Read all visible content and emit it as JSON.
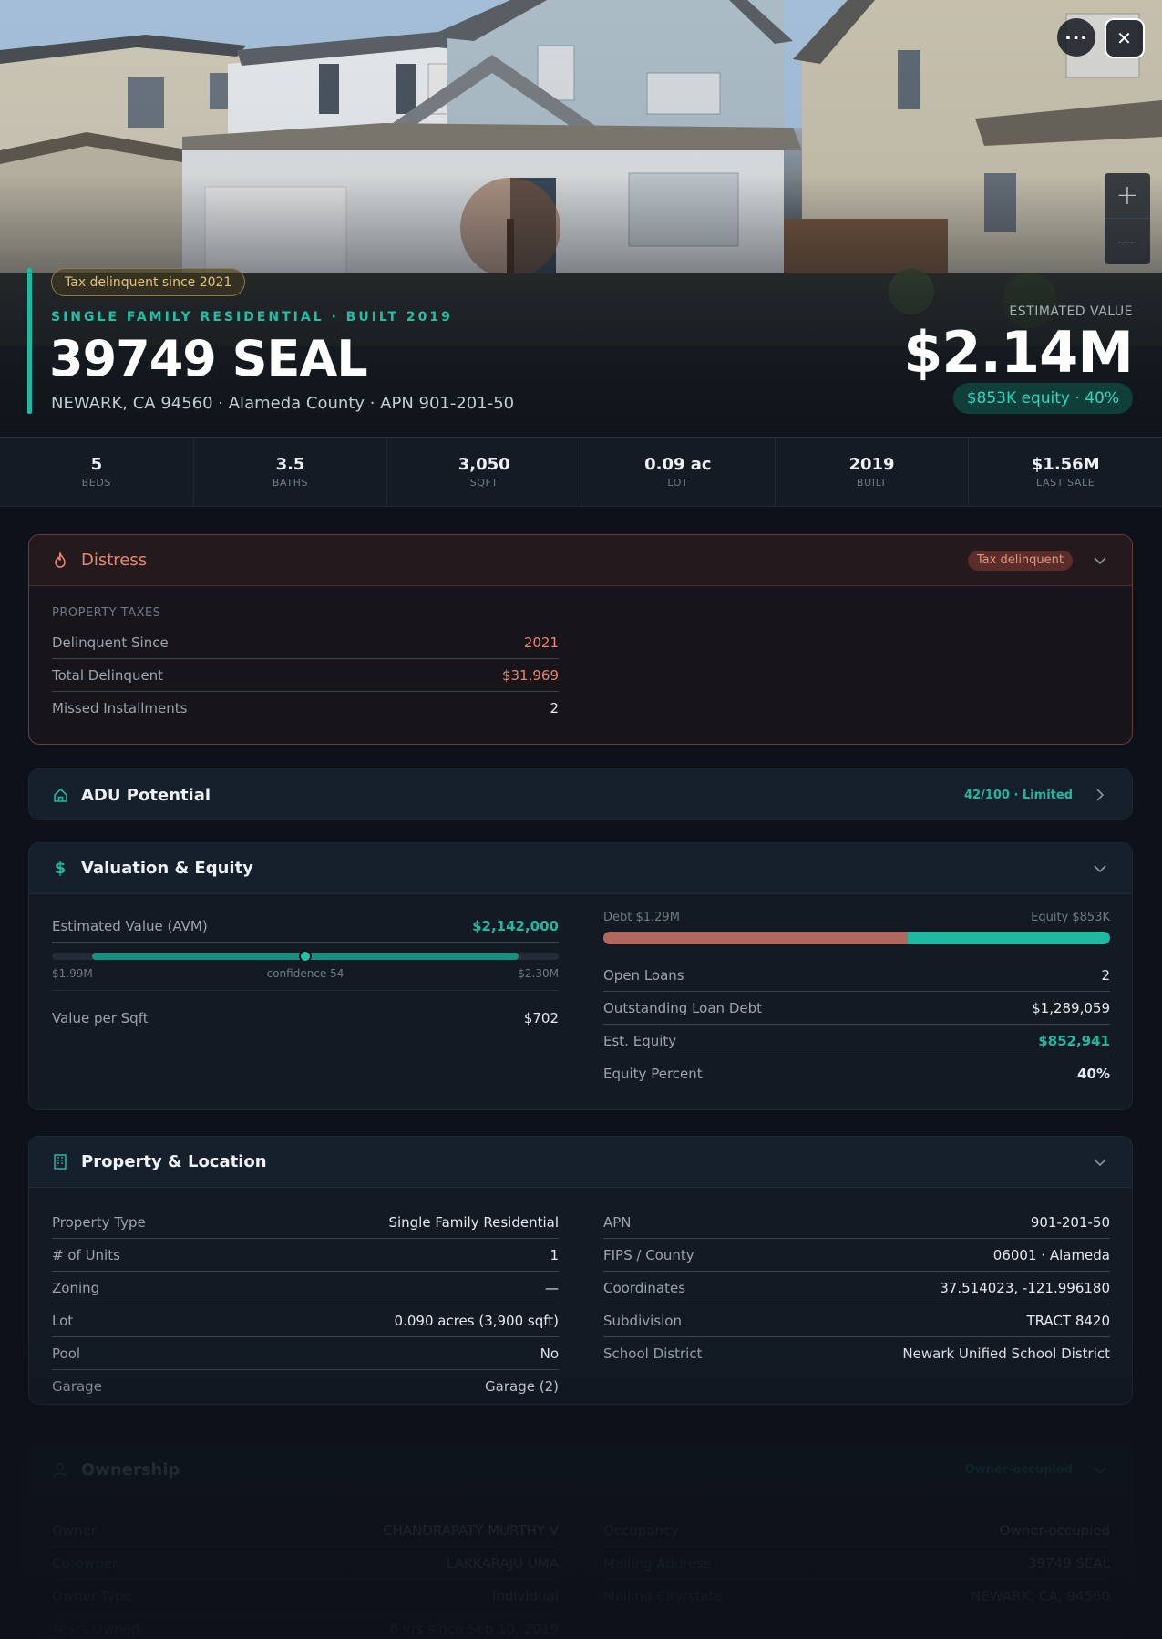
{
  "hero": {
    "tax_badge": "Tax delinquent since 2021",
    "subtitle": "SINGLE FAMILY RESIDENTIAL · BUILT 2019",
    "address": "39749 SEAL",
    "location": "NEWARK, CA 94560 · Alameda County · APN 901-201-50",
    "est_label": "ESTIMATED VALUE",
    "est_value": "$2.14M",
    "equity_badge": "$853K equity · 40%",
    "more_icon": "···",
    "close_icon": "✕",
    "zoom_in": "+",
    "zoom_out": "−"
  },
  "stats": [
    {
      "value": "5",
      "label": "BEDS"
    },
    {
      "value": "3.5",
      "label": "BATHS"
    },
    {
      "value": "3,050",
      "label": "SQFT"
    },
    {
      "value": "0.09 ac",
      "label": "LOT"
    },
    {
      "value": "2019",
      "label": "BUILT"
    },
    {
      "value": "$1.56M",
      "label": "LAST SALE"
    }
  ],
  "distress": {
    "title": "Distress",
    "badge": "Tax delinquent",
    "section_label": "PROPERTY TAXES",
    "rows": [
      {
        "k": "Delinquent Since",
        "v": "2021"
      },
      {
        "k": "Total Delinquent",
        "v": "$31,969"
      },
      {
        "k": "Missed Installments",
        "v": "2"
      }
    ]
  },
  "adu": {
    "title": "ADU Potential",
    "badge": "42/100 · Limited"
  },
  "valuation": {
    "title": "Valuation & Equity",
    "avm_label": "Estimated Value (AVM)",
    "avm_value": "$2,142,000",
    "range_low": "$1.99M",
    "confidence": "confidence 54",
    "range_high": "$2.30M",
    "range_fill_start": 0.08,
    "range_fill_end": 0.92,
    "point_position": 0.5,
    "ppsf_label": "Value per Sqft",
    "ppsf_value": "$702",
    "debt_label": "Debt $1.29M",
    "equity_label": "Equity $853K",
    "debt_fraction": 0.6,
    "rows": [
      {
        "k": "Open Loans",
        "v": "2"
      },
      {
        "k": "Outstanding Loan Debt",
        "v": "$1,289,059"
      },
      {
        "k": "Est. Equity",
        "v": "$852,941"
      },
      {
        "k": "Equity Percent",
        "v": "40%"
      }
    ]
  },
  "property": {
    "title": "Property & Location",
    "left": [
      {
        "k": "Property Type",
        "v": "Single Family Residential"
      },
      {
        "k": "# of Units",
        "v": "1"
      },
      {
        "k": "Zoning",
        "v": "—"
      },
      {
        "k": "Lot",
        "v": "0.090 acres (3,900 sqft)"
      },
      {
        "k": "Pool",
        "v": "No"
      },
      {
        "k": "Garage",
        "v": "Garage (2)"
      }
    ],
    "right": [
      {
        "k": "APN",
        "v": "901-201-50"
      },
      {
        "k": "FIPS / County",
        "v": "06001 · Alameda"
      },
      {
        "k": "Coordinates",
        "v": "37.514023, -121.996180"
      },
      {
        "k": "Subdivision",
        "v": "TRACT 8420"
      },
      {
        "k": "School District",
        "v": "Newark Unified School District"
      }
    ]
  },
  "ownership": {
    "title": "Ownership",
    "badge": "Owner-occupied",
    "left": [
      {
        "k": "Owner",
        "v": "CHANDRAPATY MURTHY V"
      },
      {
        "k": "Co-owner",
        "v": "LAKKARAJU UMA"
      },
      {
        "k": "Owner Type",
        "v": "Individual"
      },
      {
        "k": "Years Owned",
        "v": "6 yrs since Sep 10, 2019"
      }
    ],
    "right": [
      {
        "k": "Occupancy",
        "v": "Owner-occupied"
      },
      {
        "k": "Mailing Address",
        "v": "39749 SEAL"
      },
      {
        "k": "Mailing City/state",
        "v": "NEWARK, CA, 94560"
      }
    ]
  },
  "colors": {
    "accent": "#1fb8a0",
    "distress": "#e8856f",
    "debt": "#b0685c",
    "background": "#0d121a"
  }
}
